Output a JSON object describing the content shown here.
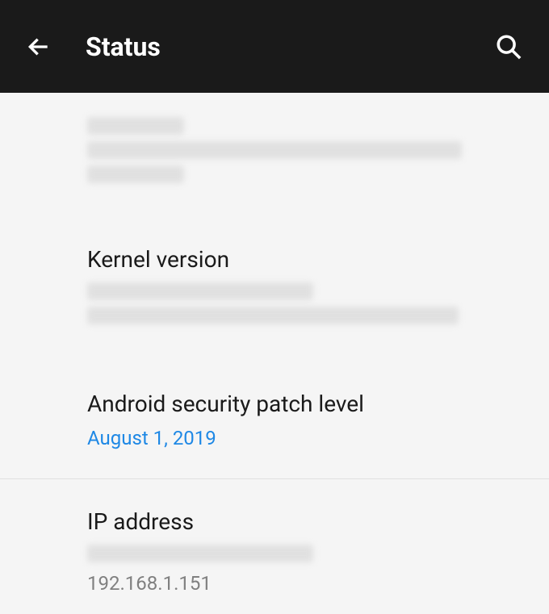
{
  "header": {
    "title": "Status"
  },
  "items": {
    "kernel": {
      "title": "Kernel version"
    },
    "security": {
      "title": "Android security patch level",
      "value": "August 1, 2019"
    },
    "ip": {
      "title": "IP address",
      "value": "192.168.1.151"
    }
  }
}
